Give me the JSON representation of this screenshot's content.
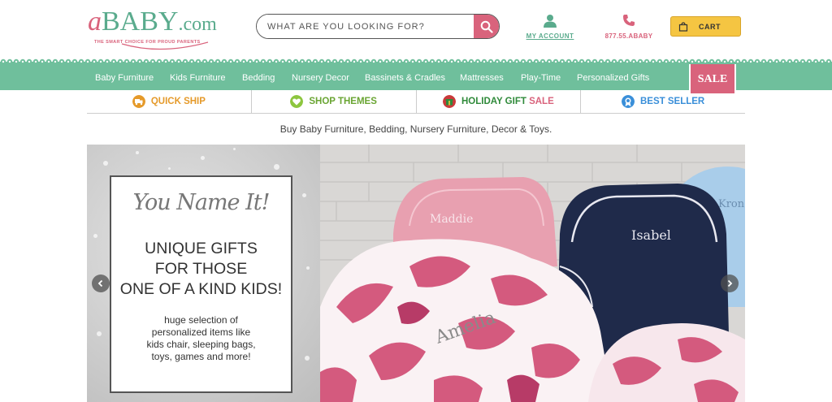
{
  "header": {
    "logo": {
      "a": "a",
      "baby": "BABY",
      "com": ".com",
      "tagline": "THE SMART CHOICE FOR PROUD PARENTS"
    },
    "search": {
      "placeholder": "WHAT ARE YOU LOOKING FOR?",
      "icon": "search-icon"
    },
    "account": {
      "label": "MY ACCOUNT",
      "icon": "user-icon"
    },
    "phone": {
      "label": "877.55.ABABY",
      "icon": "phone-icon"
    },
    "cart": {
      "label": "CART",
      "icon": "cart-icon"
    }
  },
  "nav": {
    "items": [
      "Baby Furniture",
      "Kids Furniture",
      "Bedding",
      "Nursery Decor",
      "Bassinets & Cradles",
      "Mattresses",
      "Play-Time",
      "Personalized Gifts"
    ],
    "sale": "SALE"
  },
  "quicklinks": [
    {
      "label": "QUICK SHIP",
      "color": "#e59a2a",
      "icon": "truck-icon"
    },
    {
      "label": "SHOP THEMES",
      "color": "#8dc63f",
      "icon": "heart-icon"
    },
    {
      "label_prefix": "HOLIDAY GIFT ",
      "label_suffix": "SALE",
      "color": "#2f8a3a",
      "suffix_color": "#d9637c",
      "icon": "gift-icon"
    },
    {
      "label": "BEST SELLER",
      "color": "#3a8fd9",
      "icon": "ribbon-icon"
    }
  ],
  "tagline": "Buy Baby Furniture, Bedding, Nursery Furniture, Decor & Toys.",
  "banner": {
    "script_title": "You Name It!",
    "headline": [
      "UNIQUE GIFTS",
      "FOR THOSE",
      "ONE OF A KIND KIDS!"
    ],
    "body": [
      "huge selection of",
      "personalized items like",
      "kids chair, sleeping bags,",
      "toys, games and more!"
    ],
    "chair_names": [
      "Maddie",
      "Isabel",
      "Kron",
      "Amelia"
    ]
  },
  "colors": {
    "accent_pink": "#d9637c",
    "accent_green": "#6fbf9c",
    "cart_yellow": "#f5c542"
  }
}
